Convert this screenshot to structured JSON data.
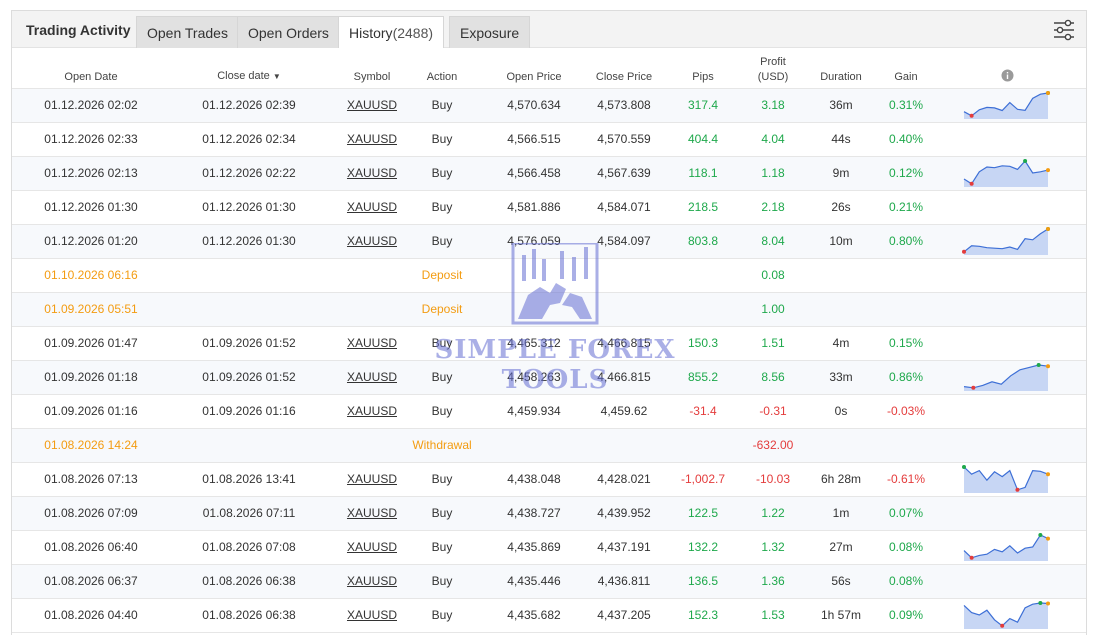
{
  "tabs": {
    "title": "Trading Activity",
    "open_trades": "Open Trades",
    "open_orders": "Open Orders",
    "history": "History",
    "history_count": "(2488)",
    "exposure": "Exposure"
  },
  "settings_icon": "sliders-icon",
  "headers": {
    "open_date": "Open Date",
    "close_date": "Close date",
    "sort_arrow": "▼",
    "symbol": "Symbol",
    "action": "Action",
    "open_price": "Open Price",
    "close_price": "Close Price",
    "pips": "Pips",
    "profit": "Profit",
    "profit_unit": "(USD)",
    "duration": "Duration",
    "gain": "Gain",
    "info_icon": "info-icon"
  },
  "rows": [
    {
      "type": "trade",
      "open": "01.12.2026 02:02",
      "close": "01.12.2026 02:39",
      "symbol": "XAUUSD",
      "action": "Buy",
      "open_price": "4,570.634",
      "close_price": "4,573.808",
      "pips": "317.4",
      "profit": "3.18",
      "duration": "36m",
      "gain": "0.31%",
      "sign": "pos",
      "spark": [
        0.22,
        0.05,
        0.3,
        0.4,
        0.38,
        0.27,
        0.6,
        0.32,
        0.28,
        0.78,
        0.95,
        1.0
      ]
    },
    {
      "type": "trade",
      "open": "01.12.2026 02:33",
      "close": "01.12.2026 02:34",
      "symbol": "XAUUSD",
      "action": "Buy",
      "open_price": "4,566.515",
      "close_price": "4,570.559",
      "pips": "404.4",
      "profit": "4.04",
      "duration": "44s",
      "gain": "0.40%",
      "sign": "pos",
      "spark": null
    },
    {
      "type": "trade",
      "open": "01.12.2026 02:13",
      "close": "01.12.2026 02:22",
      "symbol": "XAUUSD",
      "action": "Buy",
      "open_price": "4,566.458",
      "close_price": "4,567.639",
      "pips": "118.1",
      "profit": "1.18",
      "duration": "9m",
      "gain": "0.12%",
      "sign": "pos",
      "spark": [
        0.25,
        0.05,
        0.55,
        0.75,
        0.72,
        0.8,
        0.78,
        0.65,
        1.0,
        0.5,
        0.55,
        0.62
      ]
    },
    {
      "type": "trade",
      "open": "01.12.2026 01:30",
      "close": "01.12.2026 01:30",
      "symbol": "XAUUSD",
      "action": "Buy",
      "open_price": "4,581.886",
      "close_price": "4,584.071",
      "pips": "218.5",
      "profit": "2.18",
      "duration": "26s",
      "gain": "0.21%",
      "sign": "pos",
      "spark": null
    },
    {
      "type": "trade",
      "open": "01.12.2026 01:20",
      "close": "01.12.2026 01:30",
      "symbol": "XAUUSD",
      "action": "Buy",
      "open_price": "4,576.059",
      "close_price": "4,584.097",
      "pips": "803.8",
      "profit": "8.04",
      "duration": "10m",
      "gain": "0.80%",
      "sign": "pos",
      "spark": [
        0.05,
        0.3,
        0.28,
        0.22,
        0.2,
        0.18,
        0.25,
        0.15,
        0.6,
        0.55,
        0.8,
        1.0
      ]
    },
    {
      "type": "transfer",
      "open": "01.10.2026 06:16",
      "label": "Deposit",
      "profit": "0.08",
      "sign": "pos"
    },
    {
      "type": "transfer",
      "open": "01.09.2026 05:51",
      "label": "Deposit",
      "profit": "1.00",
      "sign": "pos"
    },
    {
      "type": "trade",
      "open": "01.09.2026 01:47",
      "close": "01.09.2026 01:52",
      "symbol": "XAUUSD",
      "action": "Buy",
      "open_price": "4,465.312",
      "close_price": "4,466.815",
      "pips": "150.3",
      "profit": "1.51",
      "duration": "4m",
      "gain": "0.15%",
      "sign": "pos",
      "spark": null
    },
    {
      "type": "trade",
      "open": "01.09.2026 01:18",
      "close": "01.09.2026 01:52",
      "symbol": "XAUUSD",
      "action": "Buy",
      "open_price": "4,458.263",
      "close_price": "4,466.815",
      "pips": "855.2",
      "profit": "8.56",
      "duration": "33m",
      "gain": "0.86%",
      "sign": "pos",
      "spark": [
        0.1,
        0.05,
        0.15,
        0.3,
        0.2,
        0.55,
        0.8,
        0.9,
        1.0,
        0.95
      ]
    },
    {
      "type": "trade",
      "open": "01.09.2026 01:16",
      "close": "01.09.2026 01:16",
      "symbol": "XAUUSD",
      "action": "Buy",
      "open_price": "4,459.934",
      "close_price": "4,459.62",
      "pips": "-31.4",
      "profit": "-0.31",
      "duration": "0s",
      "gain": "-0.03%",
      "sign": "neg",
      "spark": null
    },
    {
      "type": "transfer",
      "open": "01.08.2026 14:24",
      "label": "Withdrawal",
      "profit": "-632.00",
      "sign": "neg"
    },
    {
      "type": "trade",
      "open": "01.08.2026 07:13",
      "close": "01.08.2026 13:41",
      "symbol": "XAUUSD",
      "action": "Buy",
      "open_price": "4,438.048",
      "close_price": "4,428.021",
      "pips": "-1,002.7",
      "profit": "-10.03",
      "duration": "6h 28m",
      "gain": "-0.61%",
      "sign": "neg",
      "spark": [
        1.0,
        0.7,
        0.85,
        0.45,
        0.8,
        0.6,
        0.85,
        0.05,
        0.15,
        0.85,
        0.82,
        0.7
      ]
    },
    {
      "type": "trade",
      "open": "01.08.2026 07:09",
      "close": "01.08.2026 07:11",
      "symbol": "XAUUSD",
      "action": "Buy",
      "open_price": "4,438.727",
      "close_price": "4,439.952",
      "pips": "122.5",
      "profit": "1.22",
      "duration": "1m",
      "gain": "0.07%",
      "sign": "pos",
      "spark": null
    },
    {
      "type": "trade",
      "open": "01.08.2026 06:40",
      "close": "01.08.2026 07:08",
      "symbol": "XAUUSD",
      "action": "Buy",
      "open_price": "4,435.869",
      "close_price": "4,437.191",
      "pips": "132.2",
      "profit": "1.32",
      "duration": "27m",
      "gain": "0.08%",
      "sign": "pos",
      "spark": [
        0.35,
        0.05,
        0.15,
        0.2,
        0.4,
        0.3,
        0.55,
        0.25,
        0.45,
        0.5,
        1.0,
        0.85
      ]
    },
    {
      "type": "trade",
      "open": "01.08.2026 06:37",
      "close": "01.08.2026 06:38",
      "symbol": "XAUUSD",
      "action": "Buy",
      "open_price": "4,435.446",
      "close_price": "4,436.811",
      "pips": "136.5",
      "profit": "1.36",
      "duration": "56s",
      "gain": "0.08%",
      "sign": "pos",
      "spark": null
    },
    {
      "type": "trade",
      "open": "01.08.2026 04:40",
      "close": "01.08.2026 06:38",
      "symbol": "XAUUSD",
      "action": "Buy",
      "open_price": "4,435.682",
      "close_price": "4,437.205",
      "pips": "152.3",
      "profit": "1.53",
      "duration": "1h 57m",
      "gain": "0.09%",
      "sign": "pos",
      "spark": [
        0.9,
        0.6,
        0.5,
        0.7,
        0.3,
        0.05,
        0.35,
        0.2,
        0.8,
        0.95,
        1.0,
        0.98
      ]
    }
  ],
  "colors": {
    "positive": "#1ea84b",
    "negative": "#e43c3c",
    "transfer": "#f39c12",
    "spark_line": "#3d6fd6",
    "spark_fill": "#c7d6f4"
  },
  "watermark": {
    "line1": "SIMPLE FOREX",
    "line2": "TOOLS"
  }
}
